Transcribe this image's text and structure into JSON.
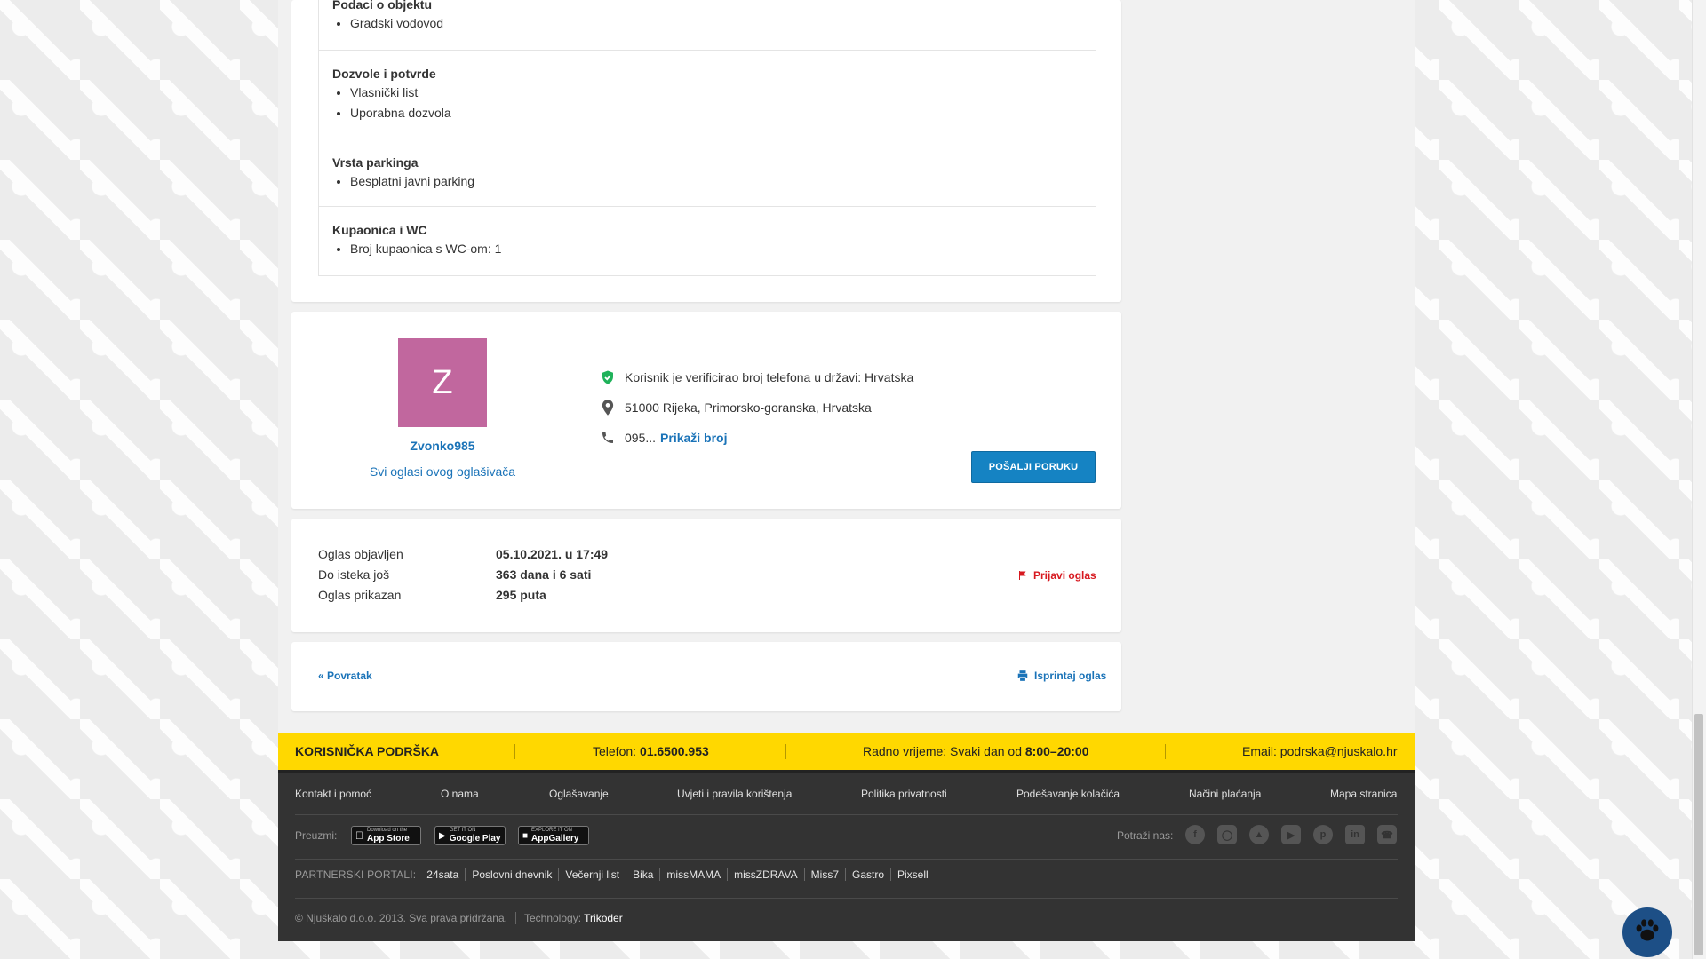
{
  "attributes": [
    {
      "title": "Podaci o objektu",
      "items": [
        "Gradski vodovod"
      ]
    },
    {
      "title": "Dozvole i potvrde",
      "items": [
        "Vlasnički list",
        "Uporabna dozvola"
      ]
    },
    {
      "title": "Vrsta parkinga",
      "items": [
        "Besplatni javni parking"
      ]
    },
    {
      "title": "Kupaonica i WC",
      "items": [
        "Broj kupaonica s WC-om: 1"
      ]
    }
  ],
  "seller": {
    "initial": "Z",
    "username": "Zvonko985",
    "all_ads_link": "Svi oglasi ovog oglašivača",
    "avatar_color": "#c1679e",
    "verified_text": "Korisnik je verificirao broj telefona u državi: Hrvatska",
    "location": "51000 Rijeka, Primorsko-goranska, Hrvatska",
    "phone_prefix": "095...",
    "show_phone_link": "Prikaži broj",
    "send_message_button": "POŠALJI PORUKU",
    "icons": {
      "verified": "shield-check-icon",
      "location": "map-pin-icon",
      "phone": "phone-icon"
    }
  },
  "stats": {
    "rows": [
      {
        "label": "Oglas objavljen",
        "value": "05.10.2021. u 17:49"
      },
      {
        "label": "Do isteka još",
        "value": "363 dana i 6 sati"
      },
      {
        "label": "Oglas prikazan",
        "value": "295 puta"
      }
    ],
    "report_link": "Prijavi oglas"
  },
  "nav": {
    "back_link": "« Povratak",
    "print_link": "Isprintaj oglas"
  },
  "support": {
    "title": "KORISNIČKA PODRŠKA",
    "phone_label": "Telefon:",
    "phone_value": "01.6500.953",
    "hours_label": "Radno vrijeme: Svaki dan od",
    "hours_value": "8:00–20:00",
    "email_label": "Email:",
    "email_value": "podrska@njuskalo.hr"
  },
  "footer": {
    "links": [
      "Kontakt i pomoć",
      "O nama",
      "Oglašavanje",
      "Uvjeti i pravila korištenja",
      "Politika privatnosti",
      "Podešavanje kolačića",
      "Načini plaćanja",
      "Mapa stranica"
    ],
    "download_label": "Preuzmi:",
    "stores": [
      {
        "small": "Download on the",
        "big": "App Store"
      },
      {
        "small": "GET IT ON",
        "big": "Google Play"
      },
      {
        "small": "EXPLORE IT ON",
        "big": "AppGallery"
      }
    ],
    "find_us_label": "Potraži nas:",
    "social": [
      "facebook-icon",
      "instagram-icon",
      "megaphone-icon",
      "youtube-icon",
      "pinterest-icon",
      "linkedin-icon",
      "viber-icon"
    ],
    "partners_label": "PARTNERSKI PORTALI:",
    "partners": [
      "24sata",
      "Poslovni dnevnik",
      "Večernji list",
      "Bika",
      "missMAMA",
      "missZDRAVA",
      "Miss7",
      "Gastro",
      "Pixsell"
    ],
    "copyright": "© Njuškalo d.o.o. 2013. Sva prava pridržana.",
    "technology_label": "Technology:",
    "technology_value": "Trikoder"
  }
}
